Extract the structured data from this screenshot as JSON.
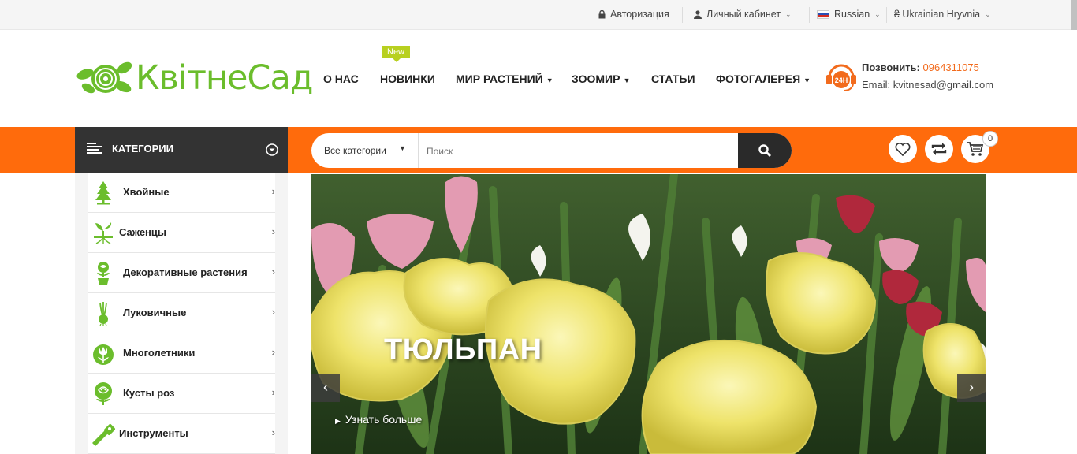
{
  "topbar": {
    "login": "Авторизация",
    "account": "Личный кабинет",
    "language": "Russian",
    "currency": "₴ Ukrainian Hryvnia"
  },
  "header": {
    "logo_text": "КвітнеСад",
    "badge_new": "New",
    "nav": {
      "about": "О НАС",
      "news": "НОВИНКИ",
      "plants": "МИР РАСТЕНИЙ",
      "zoo": "ЗООМИР",
      "articles": "СТАТЬИ",
      "gallery": "ФОТОГАЛЕРЕЯ"
    },
    "contact": {
      "call_label": "Позвонить:",
      "phone": "0964311075",
      "email_line": "Email: kvitnesad@gmail.com",
      "badge": "24H"
    }
  },
  "toolbar": {
    "categories_label": "КАТЕГОРИИ",
    "search_category": "Все категории",
    "search_placeholder": "Поиск",
    "cart_count": "0"
  },
  "categories": [
    {
      "label": "Хвойные",
      "icon": "conifer-icon"
    },
    {
      "label": "Саженцы",
      "icon": "seedling-icon"
    },
    {
      "label": "Декоративные растения",
      "icon": "rose-pot-icon"
    },
    {
      "label": "Луковичные",
      "icon": "bulb-icon"
    },
    {
      "label": "Многолетники",
      "icon": "tulip-icon"
    },
    {
      "label": "Кусты роз",
      "icon": "rose-icon"
    },
    {
      "label": "Инструменты",
      "icon": "chainsaw-icon"
    }
  ],
  "slider": {
    "title": "ТЮЛЬПАН",
    "link": "Узнать больше"
  },
  "colors": {
    "accent": "#ff6b0c",
    "brand_green": "#6bbd2c",
    "dark": "#333333"
  }
}
